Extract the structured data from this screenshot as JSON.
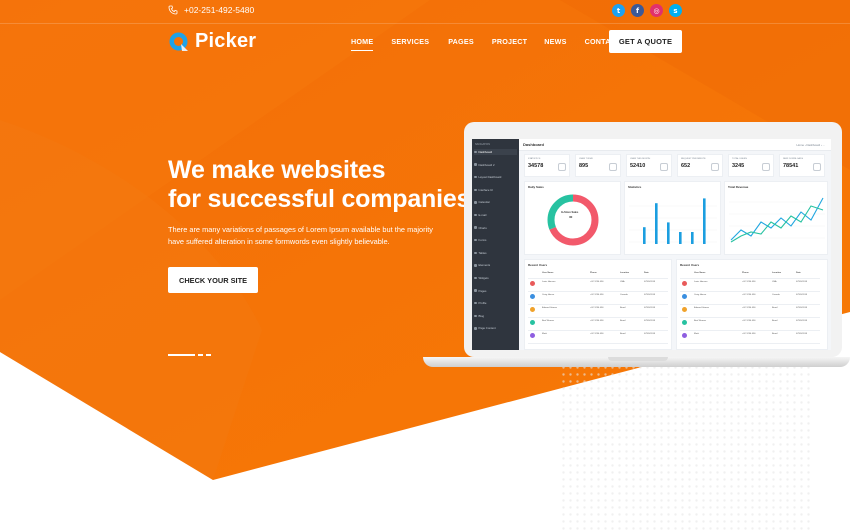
{
  "topbar": {
    "phone": "+02-251-492-5480",
    "socials": [
      {
        "icon": "twitter-icon",
        "glyph": "t",
        "color": "#1da1f2"
      },
      {
        "icon": "facebook-icon",
        "glyph": "f",
        "color": "#3b5998"
      },
      {
        "icon": "instagram-icon",
        "glyph": "◎",
        "color": "#e1306c"
      },
      {
        "icon": "skype-icon",
        "glyph": "s",
        "color": "#00aff0"
      }
    ]
  },
  "brand": {
    "name": "Picker",
    "accent": "#f47206"
  },
  "nav": {
    "items": [
      "HOME",
      "SERVICES",
      "PAGES",
      "PROJECT",
      "NEWS",
      "CONTACT"
    ],
    "active_index": 0,
    "cta": "GET A QUOTE"
  },
  "hero": {
    "title_line1": "We make websites",
    "title_line2": "for successful companies",
    "text": "There are many variations of passages of Lorem Ipsum available but the majority have suffered alteration in some formwords even slightly believable.",
    "button": "CHECK YOUR SITE"
  },
  "dashboard": {
    "title": "Dashboard",
    "breadcrumb": "Home › Dashboard › ...",
    "sidebar_items": [
      "Dashboard",
      "Dashboard 2",
      "Layout Dashboard",
      "Interface UI",
      "Calendar",
      "E-mail",
      "Charts",
      "Forms",
      "Tables",
      "Elements",
      "Widgets",
      "Pages",
      "Profile",
      "Blog",
      "Page Content"
    ],
    "stats": [
      {
        "label": "STATISTICS",
        "value": "34578"
      },
      {
        "label": "USER TODAY",
        "value": "895"
      },
      {
        "label": "USER THIS MONTH",
        "value": "52410"
      },
      {
        "label": "REQUEST PER MINUTE",
        "value": "652"
      },
      {
        "label": "TOTAL USERS",
        "value": "3245"
      },
      {
        "label": "NEW DOWNLOADS",
        "value": "78541"
      }
    ],
    "daily_sales": {
      "title": "Daily Sales",
      "center_label": "In-Store Sales",
      "center_value": "30"
    },
    "statistics_card": {
      "title": "Statistics",
      "bars": [
        0.35,
        0.85,
        0.45,
        0.25,
        0.25,
        0.95
      ]
    },
    "revenue_card": {
      "title": "Total Revenue"
    },
    "recent_users": {
      "title": "Recent Users",
      "headers": [
        "User Name",
        "Phone",
        "Location",
        "Date"
      ],
      "rows": [
        {
          "name": "Louis Hansen",
          "phone": "+02 1234 456",
          "location": "USA",
          "date": "07/05/2018"
        },
        {
          "name": "Craig Hause",
          "phone": "+02 1234 456",
          "location": "Canada",
          "date": "07/05/2018"
        },
        {
          "name": "Edward Grimes",
          "phone": "+02 1234 456",
          "location": "Brazil",
          "date": "07/05/2018"
        },
        {
          "name": "Bret Weaver",
          "phone": "+02 1234 456",
          "location": "Brazil",
          "date": "07/05/2018"
        },
        {
          "name": "Mark",
          "phone": "+02 1234 456",
          "location": "Brazil",
          "date": "07/05/2018"
        }
      ]
    }
  }
}
